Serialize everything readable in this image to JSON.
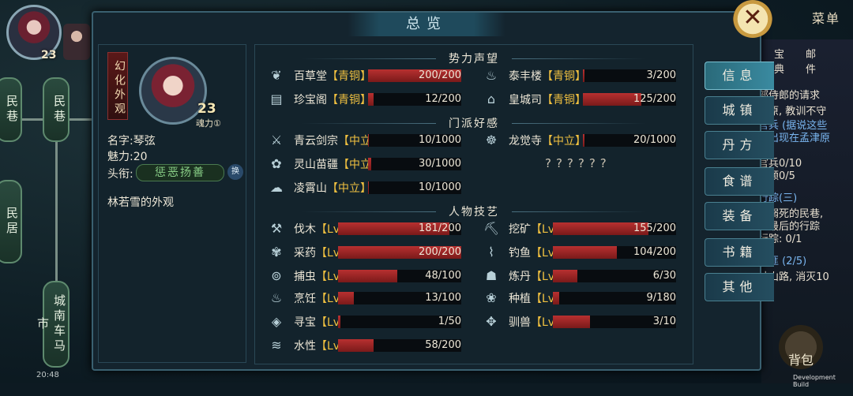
{
  "window": {
    "title": "总览",
    "menu_title": "菜单",
    "close_label": "✕"
  },
  "map": {
    "nodes": [
      "民巷",
      "民巷",
      "民居",
      "城南车马市"
    ]
  },
  "player": {
    "level": "23",
    "time": "20:48"
  },
  "profile": {
    "vertical_tag": "幻化外观",
    "level": "23",
    "soul_label": "魂力①",
    "name_label": "名字:",
    "name": "琴弦",
    "charm_label": "魅力:",
    "charm": "20",
    "title_label": "头衔:",
    "title": "惩恶扬善",
    "swap_label": "换",
    "description": "林若雪的外观"
  },
  "sections": {
    "faction": "势力声望",
    "sect": "门派好感",
    "skill": "人物技艺"
  },
  "faction_rows": [
    {
      "icon": "leaf-icon",
      "name": "百草堂",
      "tag": "【青铜】",
      "value": "200/200",
      "fill": 1.0
    },
    {
      "icon": "pot-icon",
      "name": "泰丰楼",
      "tag": "【青铜】",
      "value": "3/200",
      "fill": 0.015
    },
    {
      "icon": "chest-icon",
      "name": "珍宝阁",
      "tag": "【青铜】",
      "value": "12/200",
      "fill": 0.06
    },
    {
      "icon": "pavilion-icon",
      "name": "皇城司",
      "tag": "【青铜】",
      "value": "125/200",
      "fill": 0.625
    }
  ],
  "sect_rows": [
    {
      "icon": "sword-icon",
      "name": "青云剑宗",
      "tag": "【中立】",
      "value": "10/1000",
      "fill": 0.01
    },
    {
      "icon": "buddha-icon",
      "name": "龙觉寺",
      "tag": "【中立】",
      "value": "20/1000",
      "fill": 0.02
    },
    {
      "icon": "butterfly-icon",
      "name": "灵山苗疆",
      "tag": "【中立】",
      "value": "30/1000",
      "fill": 0.03
    },
    {
      "icon": "cloud-icon",
      "name": "凌霄山",
      "tag": "【中立】",
      "value": "10/1000",
      "fill": 0.01
    }
  ],
  "unknown_sect": "??????",
  "skill_rows": [
    {
      "icon": "axe-icon",
      "name": "伐木",
      "tag": "【Lv0】",
      "value": "181/200",
      "fill": 0.905
    },
    {
      "icon": "pickaxe-icon",
      "name": "挖矿",
      "tag": "【Lv0】",
      "value": "155/200",
      "fill": 0.775
    },
    {
      "icon": "herb-icon",
      "name": "采药",
      "tag": "【Lv0】",
      "value": "200/200",
      "fill": 1.0
    },
    {
      "icon": "fishing-icon",
      "name": "钓鱼",
      "tag": "【Lv0】",
      "value": "104/200",
      "fill": 0.52
    },
    {
      "icon": "net-icon",
      "name": "捕虫",
      "tag": "【Lv0】",
      "value": "48/100",
      "fill": 0.48
    },
    {
      "icon": "furnace-icon",
      "name": "炼丹",
      "tag": "【Lv0】",
      "value": "6/30",
      "fill": 0.2
    },
    {
      "icon": "cooking-icon",
      "name": "烹饪",
      "tag": "【Lv0】",
      "value": "13/100",
      "fill": 0.13
    },
    {
      "icon": "sprout-icon",
      "name": "种植",
      "tag": "【Lv0】",
      "value": "9/180",
      "fill": 0.05
    },
    {
      "icon": "treasure-icon",
      "name": "寻宝",
      "tag": "【Lv0】",
      "value": "1/50",
      "fill": 0.02
    },
    {
      "icon": "paw-icon",
      "name": "驯兽",
      "tag": "【Lv0】",
      "value": "3/10",
      "fill": 0.3
    },
    {
      "icon": "water-icon",
      "name": "水性",
      "tag": "【Lv1】",
      "value": "58/200",
      "fill": 0.29
    }
  ],
  "side_tabs": [
    "信息",
    "城镇",
    "丹方",
    "食谱",
    "装备",
    "书籍",
    "其他"
  ],
  "quest_panel": {
    "lines": [
      {
        "text": "部侍郎的请求",
        "blue": false
      },
      {
        "text": "津原, 教训不守",
        "blue": false
      },
      {
        "text": "官兵 (据说这些",
        "blue": true
      },
      {
        "text": "常出现在孟津原",
        "blue": true
      },
      {
        "text": "官兵0/10",
        "blue": false
      },
      {
        "text": "将领0/5",
        "blue": false
      },
      {
        "text": "行踪(三)",
        "blue": true
      },
      {
        "text": "人溺死的民巷,",
        "blue": false
      },
      {
        "text": "人最后的行踪",
        "blue": false
      },
      {
        "text": "行踪: 0/1",
        "blue": false
      },
      {
        "text": "凶匪 (2/5)",
        "blue": true
      },
      {
        "text": "林山路, 消灭10",
        "blue": false
      }
    ]
  },
  "top_icons": {
    "left": "宝典",
    "right": "邮件"
  },
  "bag_label": "背包",
  "dev_build": "Development Build",
  "colors": {
    "bar_fill": "#b83030",
    "tag": "#f0c040",
    "accent": "#3a8aa0"
  }
}
